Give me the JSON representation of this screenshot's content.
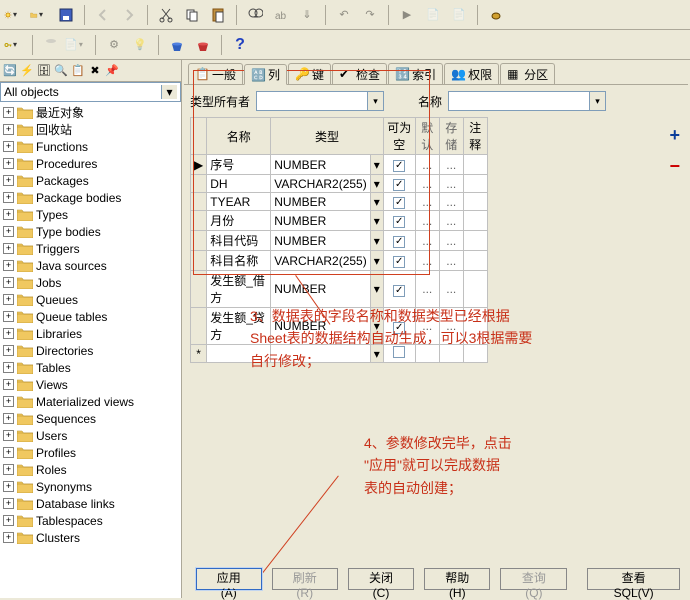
{
  "tree": {
    "combo": "All objects",
    "items": [
      {
        "label": "最近对象"
      },
      {
        "label": "回收站"
      },
      {
        "label": "Functions"
      },
      {
        "label": "Procedures"
      },
      {
        "label": "Packages"
      },
      {
        "label": "Package bodies"
      },
      {
        "label": "Types"
      },
      {
        "label": "Type bodies"
      },
      {
        "label": "Triggers"
      },
      {
        "label": "Java sources"
      },
      {
        "label": "Jobs"
      },
      {
        "label": "Queues"
      },
      {
        "label": "Queue tables"
      },
      {
        "label": "Libraries"
      },
      {
        "label": "Directories"
      },
      {
        "label": "Tables"
      },
      {
        "label": "Views"
      },
      {
        "label": "Materialized views"
      },
      {
        "label": "Sequences"
      },
      {
        "label": "Users"
      },
      {
        "label": "Profiles"
      },
      {
        "label": "Roles"
      },
      {
        "label": "Synonyms"
      },
      {
        "label": "Database links"
      },
      {
        "label": "Tablespaces"
      },
      {
        "label": "Clusters"
      }
    ]
  },
  "tabs": [
    {
      "label": "一般"
    },
    {
      "label": "列"
    },
    {
      "label": "键"
    },
    {
      "label": "检查"
    },
    {
      "label": "索引"
    },
    {
      "label": "权限"
    },
    {
      "label": "分区"
    }
  ],
  "owner": {
    "owner_label": "类型所有者",
    "name_label": "名称",
    "owner_value": "",
    "name_value": ""
  },
  "grid": {
    "headers": {
      "name": "名称",
      "type": "类型",
      "nullable": "可为空",
      "default": "默认",
      "storage": "存储",
      "comment": "注释"
    },
    "rows": [
      {
        "marker": "▶",
        "name": "序号",
        "type": "NUMBER",
        "nullable": true
      },
      {
        "marker": "",
        "name": "DH",
        "type": "VARCHAR2(255)",
        "nullable": true
      },
      {
        "marker": "",
        "name": "TYEAR",
        "type": "NUMBER",
        "nullable": true
      },
      {
        "marker": "",
        "name": "月份",
        "type": "NUMBER",
        "nullable": true
      },
      {
        "marker": "",
        "name": "科目代码",
        "type": "NUMBER",
        "nullable": true
      },
      {
        "marker": "",
        "name": "科目名称",
        "type": "VARCHAR2(255)",
        "nullable": true
      },
      {
        "marker": "",
        "name": "发生额_借方",
        "type": "NUMBER",
        "nullable": true
      },
      {
        "marker": "",
        "name": "发生额_贷方",
        "type": "NUMBER",
        "nullable": true
      }
    ],
    "newrow_marker": "*"
  },
  "annotations": {
    "a1_l1": "3、数据表的字段名称和数据类型已经根据",
    "a1_l2": "Sheet表的数据结构自动生成，可以3根据需要",
    "a1_l3": "自行修改；",
    "a2_l1": "4、参数修改完毕，点击",
    "a2_l2": "\"应用\"就可以完成数据",
    "a2_l3": "表的自动创建；"
  },
  "buttons": {
    "apply": "应用(A)",
    "refresh": "刷新(R)",
    "close": "关闭(C)",
    "help": "帮助(H)",
    "query": "查询(Q)",
    "view_sql": "查看 SQL(V)"
  },
  "ellipsis": "..."
}
